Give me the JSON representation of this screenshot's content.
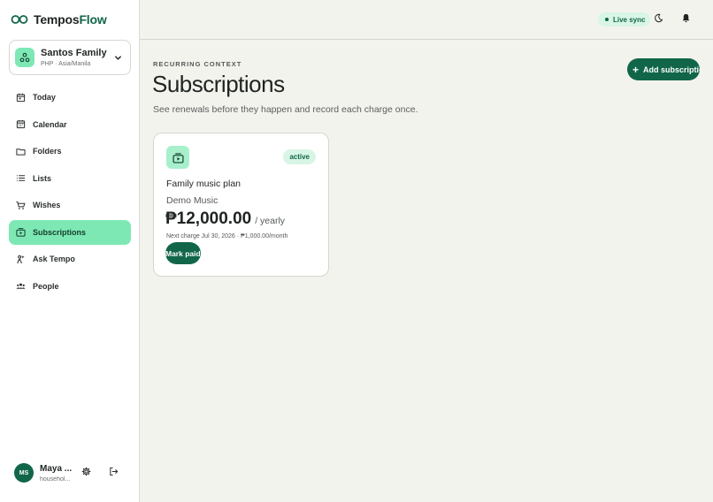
{
  "brand": {
    "name_part1": "Tempos",
    "name_part2": "Flow"
  },
  "family": {
    "name": "Santos Family",
    "subtitle": "PHP · Asia/Manila"
  },
  "nav": [
    {
      "label": "Today",
      "icon": "today-icon",
      "active": false
    },
    {
      "label": "Calendar",
      "icon": "calendar-icon",
      "active": false
    },
    {
      "label": "Folders",
      "icon": "folder-icon",
      "active": false
    },
    {
      "label": "Lists",
      "icon": "list-icon",
      "active": false
    },
    {
      "label": "Wishes",
      "icon": "cart-icon",
      "active": false
    },
    {
      "label": "Subscriptions",
      "icon": "subscriptions-icon",
      "active": true
    },
    {
      "label": "Ask Tempo",
      "icon": "ask-icon",
      "active": false
    },
    {
      "label": "People",
      "icon": "people-icon",
      "active": false
    }
  ],
  "user": {
    "initials": "MS",
    "name": "Maya ...",
    "role": "househol..."
  },
  "topbar": {
    "live_sync": "Live sync"
  },
  "page": {
    "kicker": "RECURRING CONTEXT",
    "title": "Subscriptions",
    "subtitle": "See renewals before they happen and record each charge once.",
    "add_button": "Add subscription"
  },
  "subscriptions": [
    {
      "status": "active",
      "name": "Family music plan",
      "vendor": "Demo Music",
      "amount": "₱12,000.00",
      "period": "/ yearly",
      "next_charge": "Next charge Jul 30, 2026 · ₱1,000.00/month",
      "action": "Mark paid"
    }
  ],
  "colors": {
    "accent": "#11664a",
    "accent_light": "#7ee8b4",
    "background": "#f3f3ee"
  }
}
